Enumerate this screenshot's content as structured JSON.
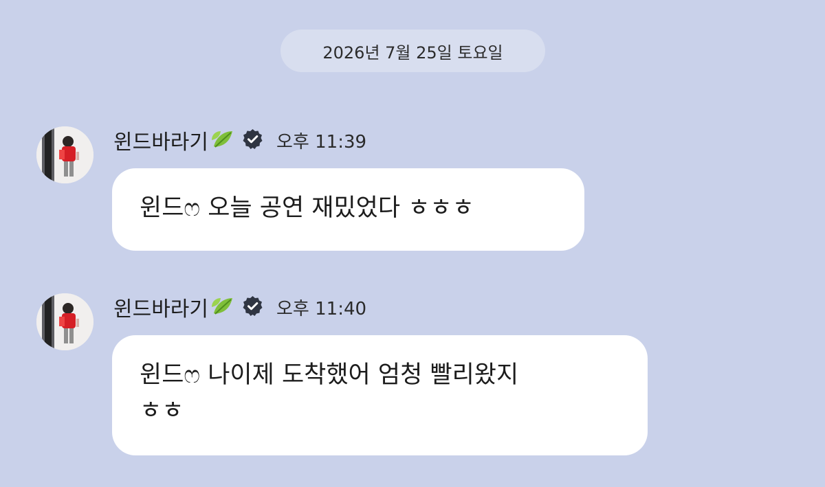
{
  "date_separator": "2026년 7월 25일 토요일",
  "messages": [
    {
      "sender": "윈드바라기",
      "time": "오후 11:39",
      "text": "윈드ෆ 오늘 공연 재밌었다 ㅎㅎㅎ",
      "icons": [
        "avatar",
        "leaf-icon",
        "verified-icon"
      ]
    },
    {
      "sender": "윈드바라기",
      "time": "오후 11:40",
      "text": "윈드ෆ 나이제 도착했어 엄청 빨리왔지\nㅎㅎ",
      "icons": [
        "avatar",
        "leaf-icon",
        "verified-icon"
      ]
    }
  ],
  "colors": {
    "background": "#c9d1ea",
    "date_pill": "#d8deef",
    "bubble": "#ffffff",
    "leaf": "#7fbf3a",
    "verified_badge": "#2f3542"
  }
}
